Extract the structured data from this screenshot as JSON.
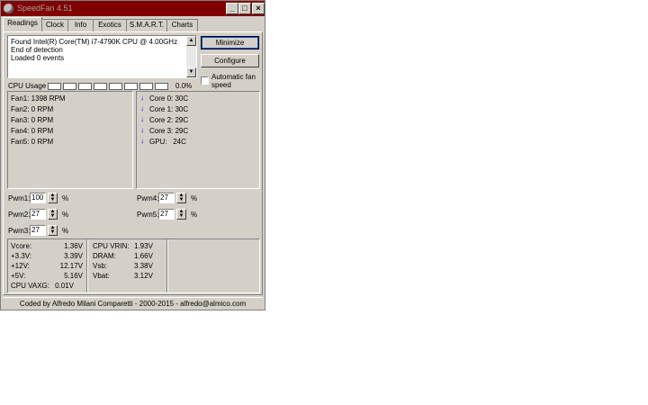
{
  "window": {
    "title": "SpeedFan 4.51",
    "minimize_glyph": "_",
    "maximize_glyph": "□",
    "close_glyph": "×",
    "title_color": "#800000"
  },
  "tabs": [
    {
      "label": "Readings",
      "active": true
    },
    {
      "label": "Clock"
    },
    {
      "label": "Info"
    },
    {
      "label": "Exotics"
    },
    {
      "label": "S.M.A.R.T."
    },
    {
      "label": "Charts"
    }
  ],
  "log": {
    "lines": [
      "Found Intel(R) Core(TM) i7-4790K CPU @ 4.00GHz",
      "End of detection",
      "Loaded 0 events"
    ]
  },
  "buttons": {
    "minimize": "Minimize",
    "configure": "Configure"
  },
  "auto_fan": {
    "label_line1": "Automatic fan",
    "label_line2": "speed",
    "checked": false
  },
  "cpu_usage": {
    "label": "CPU Usage",
    "value": "0.0%"
  },
  "fans": [
    "Fan1: 1398 RPM",
    "Fan2: 0 RPM",
    "Fan3: 0 RPM",
    "Fan4: 0 RPM",
    "Fan5: 0 RPM"
  ],
  "temps": [
    {
      "icon": "↓",
      "label": "Core 0: 30C"
    },
    {
      "icon": "↓",
      "label": "Core 1: 30C"
    },
    {
      "icon": "↓",
      "label": "Core 2: 29C"
    },
    {
      "icon": "↓",
      "label": "Core 3: 29C"
    },
    {
      "icon": "↓",
      "label": "GPU:   24C"
    }
  ],
  "pwm": [
    {
      "label": "Pwm1:",
      "value": "100",
      "unit": "%"
    },
    {
      "label": "Pwm2:",
      "value": "27",
      "unit": "%"
    },
    {
      "label": "Pwm3:",
      "value": "27",
      "unit": "%"
    },
    {
      "label": "Pwm4:",
      "value": "27",
      "unit": "%"
    },
    {
      "label": "Pwm5:",
      "value": "27",
      "unit": "%"
    }
  ],
  "voltages_left": [
    {
      "label": "Vcore:",
      "value": "1.36V"
    },
    {
      "label": "+3.3V:",
      "value": "3.39V"
    },
    {
      "label": "+12V:",
      "value": "12.17V"
    },
    {
      "label": "+5V:",
      "value": "5.16V"
    },
    {
      "label": "CPU VAXG:",
      "value": "0.01V"
    }
  ],
  "voltages_right": [
    {
      "label": "CPU VRIN:",
      "value": "1.93V"
    },
    {
      "label": "DRAM:",
      "value": "1.66V"
    },
    {
      "label": "Vsb:",
      "value": "3.38V"
    },
    {
      "label": "Vbat:",
      "value": "3.12V"
    }
  ],
  "status_bar": "Coded by Alfredo Milani Comparetti - 2000-2015 - alfredo@almico.com"
}
